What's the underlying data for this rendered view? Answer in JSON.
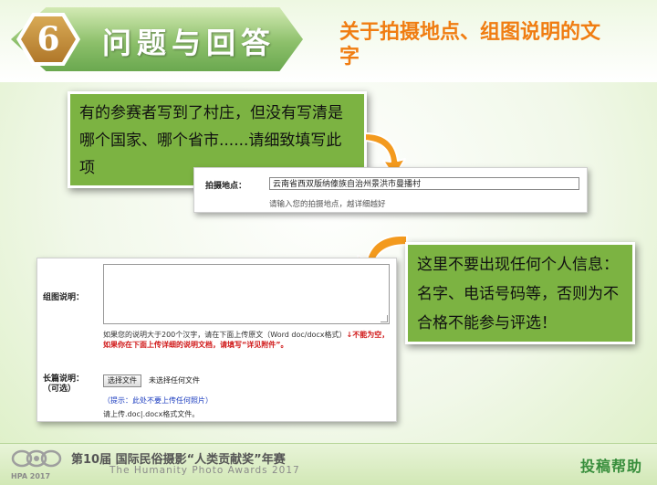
{
  "header": {
    "badge_number": "6",
    "banner_title": "问题与回答",
    "subtitle": "关于拍摄地点、组图说明的文字"
  },
  "callout_village": {
    "text": "有的参赛者写到了村庄，但没有写清是哪个国家、哪个省市......请细致填写此项"
  },
  "callout_personal": {
    "text": "这里不要出现任何个人信息：名字、电话号码等，否则为不合格不能参与评选！"
  },
  "location_form": {
    "label": "拍摄地点：",
    "value": "云南省西双版纳傣族自治州景洪市曼播村",
    "hint": "请输入您的拍摄地点，越详细越好"
  },
  "group_form": {
    "desc_label": "组图说明：",
    "note_prefix": "如果您的说明大于200个汉字，请在下面上传原文（Word doc/docx格式）",
    "note_red": "↓不能为空，如果你在下面上传详细的说明文档，请填写“详见附件”。",
    "long_label": "长篇说明：",
    "long_label_optional": "（可选）",
    "file_button": "选择文件",
    "file_status": "未选择任何文件",
    "blue_note": "（提示：此处不要上传任何照片）",
    "doc_note": "请上传.doc|.docx格式文件。"
  },
  "footer": {
    "logo_text": "HPA 2017",
    "title_cn": "第10届 国际民俗摄影“人类贡献奖”年赛",
    "title_en": "The Humanity Photo Awards 2017",
    "help_label": "投稿帮助"
  },
  "colors": {
    "accent_orange": "#f07d12",
    "callout_green": "#7cb342",
    "banner_green": "#8dc06b",
    "badge_gold": "#c38d3a",
    "warning_red": "#d01818",
    "hint_blue": "#1a3bbf",
    "help_green": "#388e3c"
  }
}
